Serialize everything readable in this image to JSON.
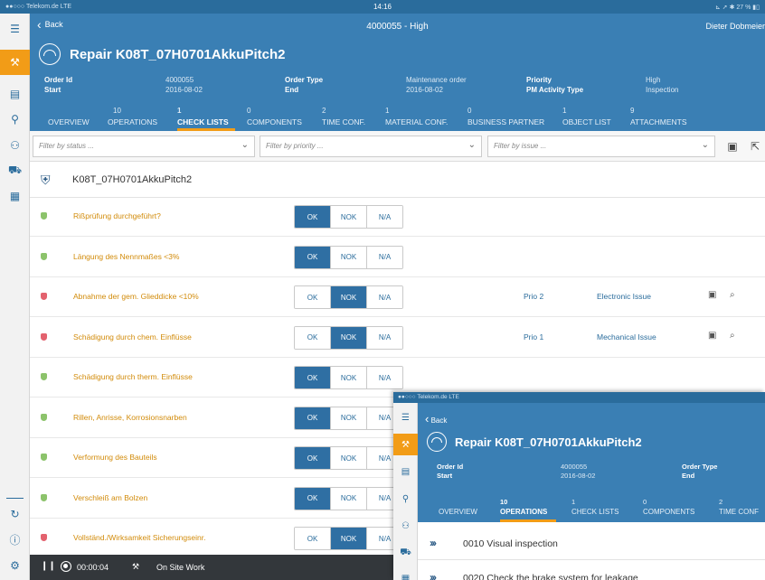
{
  "statusbar": {
    "carrier": "●●○○○ Telekom.de  LTE",
    "time": "14:16",
    "battery": "⊾ ➚ ✱ 27 % ▮▯"
  },
  "rail": [
    "menu-icon",
    "tools-icon",
    "message-icon",
    "search-icon",
    "team-icon",
    "truck-icon",
    "document-icon",
    "sync-icon",
    "info-icon",
    "settings-icon"
  ],
  "header": {
    "back_label": "Back",
    "nav_title": "4000055 - High",
    "user": "Dieter Dobmeier",
    "title": "Repair K08T_07H0701AkkuPitch2",
    "meta": [
      {
        "label": "Order Id",
        "value": "4000055"
      },
      {
        "label": "Start",
        "value": "2016-08-02"
      },
      {
        "label": "Order Type",
        "value": "Maintenance order"
      },
      {
        "label": "End",
        "value": "2016-08-02"
      },
      {
        "label": "Priority",
        "value": "High"
      },
      {
        "label": "PM Activity Type",
        "value": "Inspection"
      }
    ],
    "tabs": [
      {
        "count": "",
        "label": "Overview"
      },
      {
        "count": "10",
        "label": "Operations"
      },
      {
        "count": "1",
        "label": "Check Lists"
      },
      {
        "count": "0",
        "label": "Components"
      },
      {
        "count": "2",
        "label": "Time Conf."
      },
      {
        "count": "1",
        "label": "Material Conf."
      },
      {
        "count": "0",
        "label": "Business Partner"
      },
      {
        "count": "1",
        "label": "Object List"
      },
      {
        "count": "9",
        "label": "Attachments"
      }
    ]
  },
  "filters": {
    "status_placeholder": "Filter by status ...",
    "priority_placeholder": "Filter by priority ...",
    "issue_placeholder": "Filter by issue ..."
  },
  "object": {
    "name": "K08T_07H0701AkkuPitch2"
  },
  "segment_labels": [
    "OK",
    "NOK",
    "N/A"
  ],
  "checklist": [
    {
      "text": "Rißprüfung durchgeführt?",
      "status": "ok",
      "selected": "OK",
      "prio": "",
      "issue": ""
    },
    {
      "text": "Längung des Nennmaßes <3%",
      "status": "ok",
      "selected": "OK",
      "prio": "",
      "issue": ""
    },
    {
      "text": "Abnahme der gem. Glieddicke <10%",
      "status": "nok",
      "selected": "NOK",
      "prio": "Prio 2",
      "issue": "Electronic Issue"
    },
    {
      "text": "Schädigung durch chem. Einflüsse",
      "status": "nok",
      "selected": "NOK",
      "prio": "Prio 1",
      "issue": "Mechanical Issue"
    },
    {
      "text": "Schädigung durch therm. Einflüsse",
      "status": "ok",
      "selected": "OK",
      "prio": "",
      "issue": ""
    },
    {
      "text": "Rillen, Anrisse, Korrosionsnarben",
      "status": "ok",
      "selected": "OK",
      "prio": "",
      "issue": ""
    },
    {
      "text": "Verformung des Bauteils",
      "status": "ok",
      "selected": "OK",
      "prio": "",
      "issue": ""
    },
    {
      "text": "Verschleiß am Bolzen",
      "status": "ok",
      "selected": "OK",
      "prio": "",
      "issue": ""
    },
    {
      "text": "Vollständ./Wirksamkeit Sicherungseinr.",
      "status": "nok",
      "selected": "NOK",
      "prio": "",
      "issue": ""
    }
  ],
  "bottombar": {
    "timer": "00:00:04",
    "status": "On Site Work"
  },
  "overlay": {
    "statusbar": "●●○○○ Telekom.de  LTE",
    "back_label": "Back",
    "title": "Repair K08T_07H0701AkkuPitch2",
    "meta": [
      {
        "label": "Order Id",
        "value": "4000055"
      },
      {
        "label": "Start",
        "value": "2016-08-02"
      },
      {
        "label": "Order Type",
        "value": ""
      },
      {
        "label": "End",
        "value": ""
      }
    ],
    "tabs": [
      {
        "count": "",
        "label": "Overview"
      },
      {
        "count": "10",
        "label": "Operations"
      },
      {
        "count": "1",
        "label": "Check Lists"
      },
      {
        "count": "0",
        "label": "Components"
      },
      {
        "count": "2",
        "label": "Time Conf"
      }
    ],
    "operations": [
      {
        "text": "0010 Visual inspection"
      },
      {
        "text": "0020 Check the brake system for leakage"
      }
    ]
  }
}
